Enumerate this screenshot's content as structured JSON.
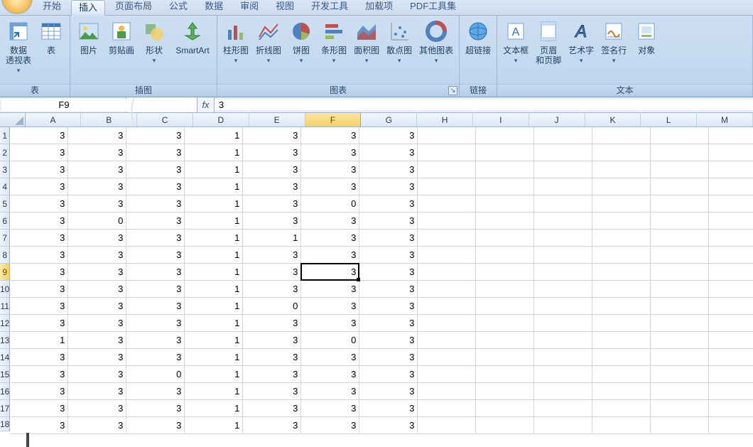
{
  "tabs": {
    "items": [
      "开始",
      "插入",
      "页面布局",
      "公式",
      "数据",
      "审阅",
      "视图",
      "开发工具",
      "加载项",
      "PDF工具集"
    ],
    "active_index": 1
  },
  "ribbon": {
    "group_table": {
      "title": "表",
      "pivot": "数据\n透视表",
      "table": "表"
    },
    "group_illus": {
      "title": "插图",
      "picture": "图片",
      "clipart": "剪贴画",
      "shapes": "形状",
      "smartart": "SmartArt"
    },
    "group_chart": {
      "title": "图表",
      "column": "柱形图",
      "line": "折线图",
      "pie": "饼图",
      "bar": "条形图",
      "area": "面积图",
      "scatter": "散点图",
      "other": "其他图表"
    },
    "group_link": {
      "title": "链接",
      "hyper": "超链接"
    },
    "group_text": {
      "title": "文本",
      "textbox": "文本框",
      "headerfooter": "页眉\n和页脚",
      "wordart": "艺术字",
      "sigline": "签名行",
      "object": "对象"
    }
  },
  "formula_bar": {
    "name_box": "F9",
    "fx_label": "fx",
    "value": "3"
  },
  "columns": [
    "A",
    "B",
    "C",
    "D",
    "E",
    "F",
    "G",
    "H",
    "I",
    "J",
    "K",
    "L",
    "M"
  ],
  "active": {
    "col_index": 5,
    "row_index": 8
  },
  "chart_data": {
    "type": "table",
    "columns": [
      "A",
      "B",
      "C",
      "D",
      "E",
      "F",
      "G"
    ],
    "rows": [
      [
        3,
        3,
        3,
        1,
        3,
        3,
        3
      ],
      [
        3,
        3,
        3,
        1,
        3,
        3,
        3
      ],
      [
        3,
        3,
        3,
        1,
        3,
        3,
        3
      ],
      [
        3,
        3,
        3,
        1,
        3,
        3,
        3
      ],
      [
        3,
        3,
        3,
        1,
        3,
        0,
        3
      ],
      [
        3,
        0,
        3,
        1,
        3,
        3,
        3
      ],
      [
        3,
        3,
        3,
        1,
        1,
        3,
        3
      ],
      [
        3,
        3,
        3,
        1,
        3,
        3,
        3
      ],
      [
        3,
        3,
        3,
        1,
        3,
        3,
        3
      ],
      [
        3,
        3,
        3,
        1,
        3,
        3,
        3
      ],
      [
        3,
        3,
        3,
        1,
        0,
        3,
        3
      ],
      [
        3,
        3,
        3,
        1,
        3,
        3,
        3
      ],
      [
        1,
        3,
        3,
        1,
        3,
        0,
        3
      ],
      [
        3,
        3,
        3,
        1,
        3,
        3,
        3
      ],
      [
        3,
        3,
        0,
        1,
        3,
        3,
        3
      ],
      [
        3,
        3,
        3,
        1,
        3,
        3,
        3
      ],
      [
        3,
        3,
        3,
        1,
        3,
        3,
        3
      ],
      [
        3,
        3,
        3,
        1,
        3,
        3,
        3
      ]
    ]
  },
  "dd_glyph": "▾",
  "launcher_glyph": "↘"
}
